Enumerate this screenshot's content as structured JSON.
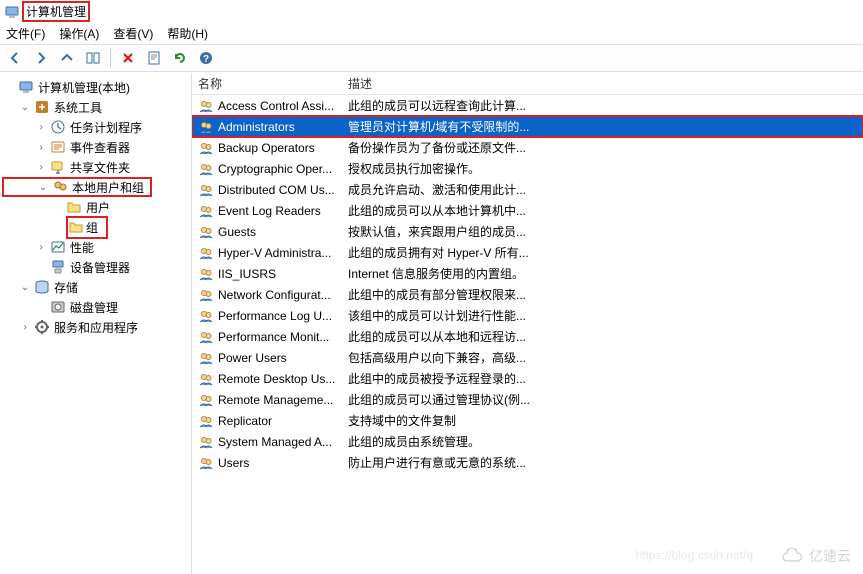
{
  "title": "计算机管理",
  "menus": {
    "file": "文件(F)",
    "action": "操作(A)",
    "view": "查看(V)",
    "help": "帮助(H)"
  },
  "tree": {
    "root": "计算机管理(本地)",
    "system_tools": "系统工具",
    "task_scheduler": "任务计划程序",
    "event_viewer": "事件查看器",
    "shared_folders": "共享文件夹",
    "local_users_groups": "本地用户和组",
    "users": "用户",
    "groups": "组",
    "performance": "性能",
    "device_manager": "设备管理器",
    "storage": "存储",
    "disk_management": "磁盘管理",
    "services_apps": "服务和应用程序"
  },
  "columns": {
    "name": "名称",
    "desc": "描述"
  },
  "groups": [
    {
      "name": "Access Control Assi...",
      "desc": "此组的成员可以远程查询此计算..."
    },
    {
      "name": "Administrators",
      "desc": "管理员对计算机/域有不受限制的...",
      "selected": true
    },
    {
      "name": "Backup Operators",
      "desc": "备份操作员为了备份或还原文件..."
    },
    {
      "name": "Cryptographic Oper...",
      "desc": "授权成员执行加密操作。"
    },
    {
      "name": "Distributed COM Us...",
      "desc": "成员允许启动、激活和使用此计..."
    },
    {
      "name": "Event Log Readers",
      "desc": "此组的成员可以从本地计算机中..."
    },
    {
      "name": "Guests",
      "desc": "按默认值，来宾跟用户组的成员..."
    },
    {
      "name": "Hyper-V Administra...",
      "desc": "此组的成员拥有对 Hyper-V 所有..."
    },
    {
      "name": "IIS_IUSRS",
      "desc": "Internet 信息服务使用的内置组。"
    },
    {
      "name": "Network Configurat...",
      "desc": "此组中的成员有部分管理权限来..."
    },
    {
      "name": "Performance Log U...",
      "desc": "该组中的成员可以计划进行性能..."
    },
    {
      "name": "Performance Monit...",
      "desc": "此组的成员可以从本地和远程访..."
    },
    {
      "name": "Power Users",
      "desc": "包括高级用户以向下兼容，高级..."
    },
    {
      "name": "Remote Desktop Us...",
      "desc": "此组中的成员被授予远程登录的..."
    },
    {
      "name": "Remote Manageme...",
      "desc": "此组的成员可以通过管理协议(例..."
    },
    {
      "name": "Replicator",
      "desc": "支持域中的文件复制"
    },
    {
      "name": "System Managed A...",
      "desc": "此组的成员由系统管理。"
    },
    {
      "name": "Users",
      "desc": "防止用户进行有意或无意的系统..."
    }
  ],
  "watermark": {
    "text": "亿速云",
    "url": "https://blog.csdn.net/q"
  }
}
